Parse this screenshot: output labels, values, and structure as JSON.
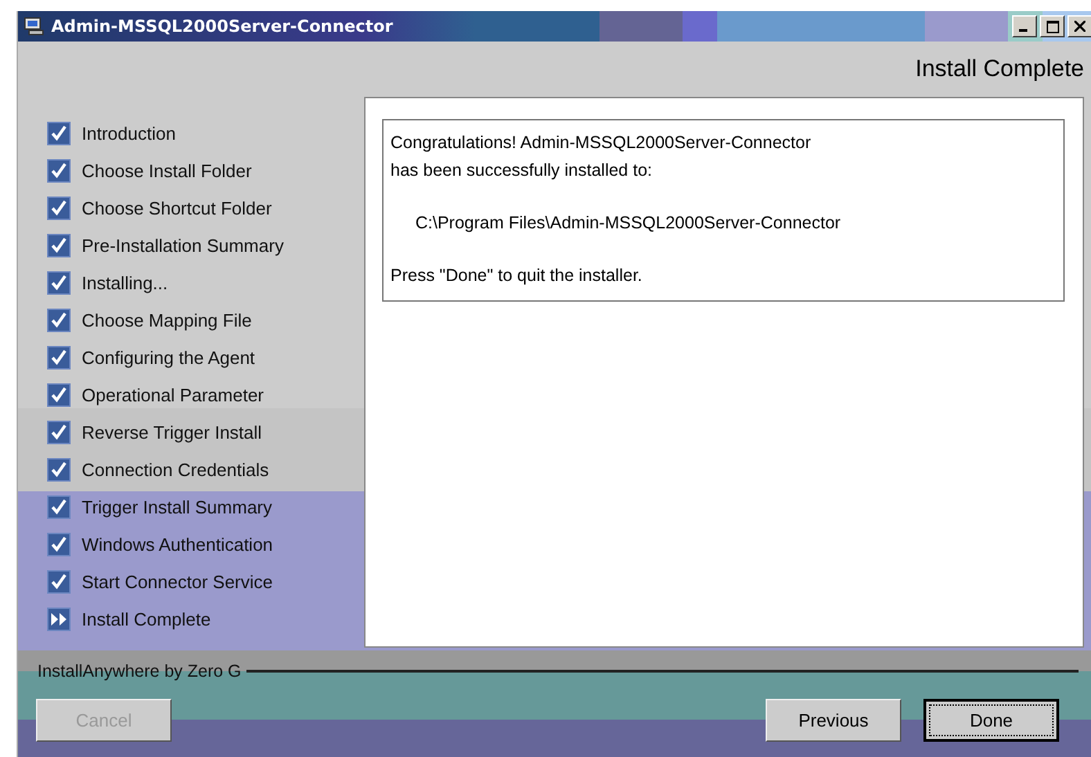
{
  "window": {
    "title": "Admin-MSSQL2000Server-Connector"
  },
  "header": {
    "title": "Install Complete"
  },
  "steps": [
    {
      "label": "Introduction",
      "kind": "done"
    },
    {
      "label": "Choose Install Folder",
      "kind": "done"
    },
    {
      "label": "Choose Shortcut Folder",
      "kind": "done"
    },
    {
      "label": "Pre-Installation Summary",
      "kind": "done"
    },
    {
      "label": "Installing...",
      "kind": "done"
    },
    {
      "label": "Choose Mapping File",
      "kind": "done"
    },
    {
      "label": "Configuring the Agent",
      "kind": "done"
    },
    {
      "label": "Operational Parameter",
      "kind": "done"
    },
    {
      "label": "Reverse Trigger Install",
      "kind": "done"
    },
    {
      "label": "Connection Credentials",
      "kind": "done"
    },
    {
      "label": "Trigger Install Summary",
      "kind": "done"
    },
    {
      "label": "Windows Authentication",
      "kind": "done"
    },
    {
      "label": "Start Connector Service",
      "kind": "done"
    },
    {
      "label": "Install Complete",
      "kind": "current"
    }
  ],
  "message": {
    "lines": [
      {
        "text": "Congratulations! Admin-MSSQL2000Server-Connector",
        "indent": false
      },
      {
        "text": "has been successfully installed to:",
        "indent": false
      },
      {
        "text": "C:\\Program Files\\Admin-MSSQL2000Server-Connector",
        "indent": true
      },
      {
        "text": "Press \"Done\" to quit the installer.",
        "indent": false
      }
    ]
  },
  "footer": {
    "label": "InstallAnywhere by Zero G"
  },
  "buttons": [
    {
      "label": "Cancel",
      "disabled": true,
      "focused": false
    },
    {
      "label": "Previous",
      "disabled": false,
      "focused": false
    },
    {
      "label": "Done",
      "disabled": false,
      "focused": true
    }
  ]
}
